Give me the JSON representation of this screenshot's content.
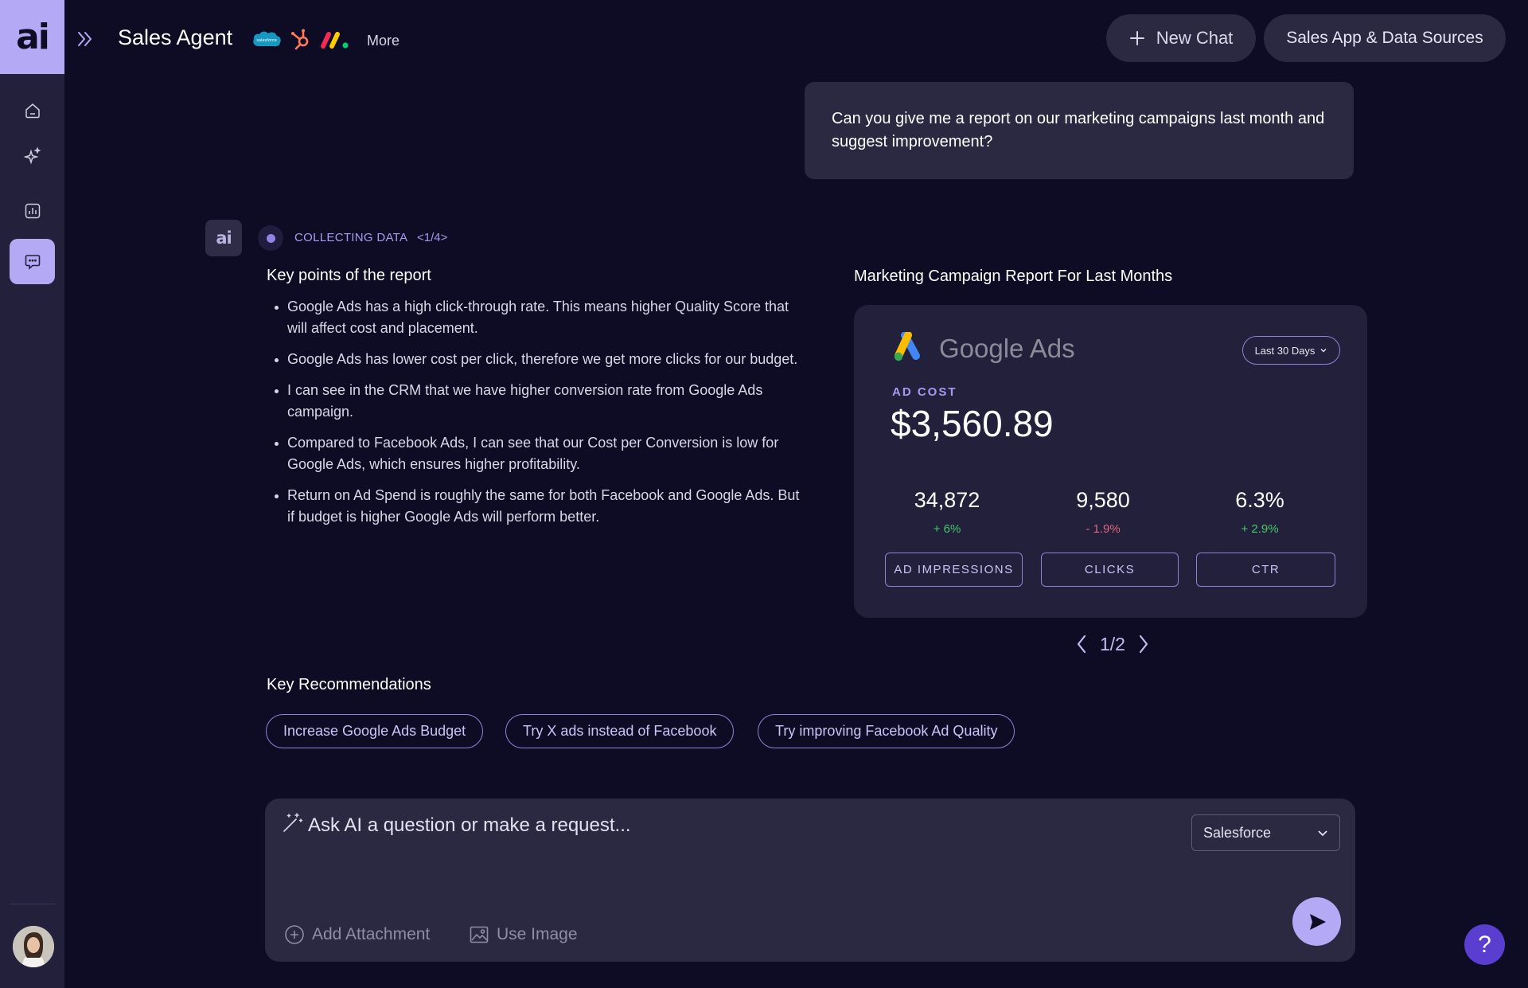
{
  "app": {
    "logo_text": "ai",
    "title": "Sales Agent",
    "more_label": "More",
    "integrations": [
      "salesforce-icon",
      "hubspot-icon",
      "monday-icon"
    ],
    "new_chat_label": "New Chat",
    "sources_label": "Sales App & Data Sources",
    "accent_color": "#b4a9f4"
  },
  "sidebar": {
    "items": [
      {
        "name": "home",
        "icon": "home-icon",
        "active": false
      },
      {
        "name": "ai-sparkles",
        "icon": "sparkles-icon",
        "active": false
      },
      {
        "name": "reports",
        "icon": "chart-icon",
        "active": false
      },
      {
        "name": "chat",
        "icon": "chat-icon",
        "active": true
      }
    ]
  },
  "conversation": {
    "user_message": "Can you give me a report on our marketing campaigns last month and suggest improvement?",
    "ai_avatar_text": "ai",
    "status": "COLLECTING DATA",
    "status_step": "<1/4>",
    "key_points_title": "Key points of the report",
    "key_points": [
      "Google Ads has a high click-through rate. This means higher Quality Score that will affect cost and placement.",
      "Google Ads has lower cost per click, therefore we get more clicks for our budget.",
      "I can see in the CRM that we have higher conversion rate from Google Ads campaign.",
      "Compared to Facebook Ads, I can see that our Cost per Conversion is low for Google Ads, which ensures higher profitability.",
      "Return on Ad Spend is roughly the same for both Facebook and Google Ads. But if budget is higher Google Ads will perform better."
    ],
    "report_title": "Marketing Campaign Report For Last Months",
    "recommendations_title": "Key Recommendations",
    "recommendations": [
      "Increase Google Ads Budget",
      "Try X ads instead of Facebook",
      "Try improving Facebook Ad Quality"
    ]
  },
  "card": {
    "platform": "Google Ads",
    "range": "Last 30 Days",
    "ad_cost_label": "AD COST",
    "ad_cost_value": "$3,560.89",
    "metrics": [
      {
        "value": "34,872",
        "change": "+ 6%",
        "direction": "up",
        "label": "AD IMPRESSIONS"
      },
      {
        "value": "9,580",
        "change": "- 1.9%",
        "direction": "down",
        "label": "CLICKS"
      },
      {
        "value": "6.3%",
        "change": "+ 2.9%",
        "direction": "up",
        "label": "CTR"
      }
    ],
    "pager": "1/2"
  },
  "composer": {
    "placeholder": "Ask AI a question or make a request...",
    "source": "Salesforce",
    "attach_label": "Add Attachment",
    "image_label": "Use Image"
  },
  "help_label": "?"
}
